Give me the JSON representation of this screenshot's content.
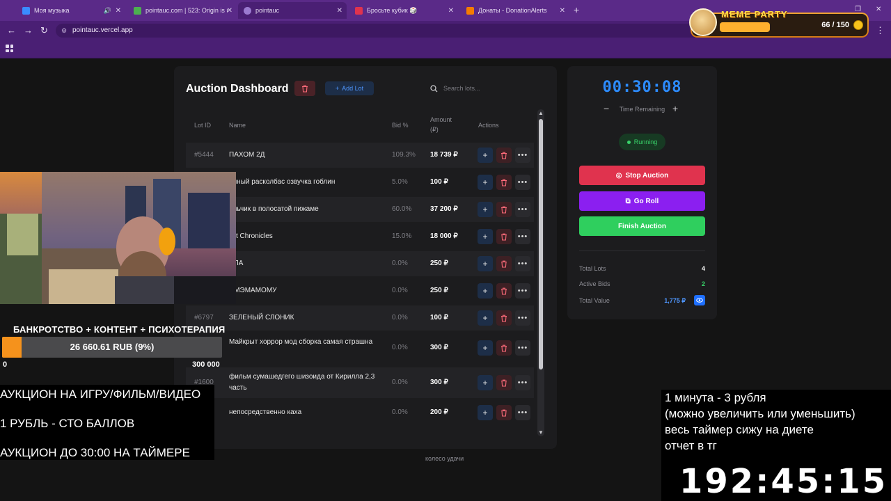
{
  "browser": {
    "tabs": [
      {
        "title": "Моя музыка",
        "active": false,
        "color": "#3a8cff"
      },
      {
        "title": "pointauc.com | 523: Origin is unr",
        "active": false,
        "color": "#4caf50"
      },
      {
        "title": "pointauc",
        "active": true,
        "color": "#9b7ad0"
      },
      {
        "title": "Бросьте кубик 🎲",
        "active": false,
        "color": "#e0334e"
      },
      {
        "title": "Донаты - DonationAlerts",
        "active": false,
        "color": "#f57c00"
      }
    ],
    "url": "pointauc.vercel.app"
  },
  "meme_widget": {
    "label": "MEME PARTY",
    "count": "66 / 150"
  },
  "dashboard": {
    "title": "Auction Dashboard",
    "add_lot_label": "Add Lot",
    "search_placeholder": "Search lots...",
    "columns": {
      "lot_id": "Lot ID",
      "name": "Name",
      "bid": "Bid %",
      "amount": "Amount",
      "amount_unit": "(₽)",
      "actions": "Actions"
    },
    "lots": [
      {
        "id": "#5444",
        "name": "ПАХОМ 2Д",
        "bid": "109.3%",
        "amount": "18 739 ₽"
      },
      {
        "id": "",
        "name": "олный расколбас озвучка гоблин",
        "bid": "5.0%",
        "amount": "100 ₽"
      },
      {
        "id": "",
        "name": "альчик в полосатой пижаме",
        "bid": "60.0%",
        "amount": "37 200 ₽"
      },
      {
        "id": "",
        "name": "ilet Chronicles",
        "bid": "15.0%",
        "amount": "18 000 ₽"
      },
      {
        "id": "",
        "name": "ИЛА",
        "bid": "0.0%",
        "amount": "250 ₽"
      },
      {
        "id": "",
        "name": "ИМЭМАМОМУ",
        "bid": "0.0%",
        "amount": "250 ₽"
      },
      {
        "id": "#6797",
        "name": "ЗЕЛЕНЫЙ СЛОНИК",
        "bid": "0.0%",
        "amount": "100 ₽"
      },
      {
        "id": "",
        "name": "Майкрыт хоррор мод сборка самая страшна",
        "bid": "0.0%",
        "amount": "300 ₽"
      },
      {
        "id": "#1600",
        "name": "фильм сумашедгего шизоида от Кирилла 2,3 часть",
        "bid": "0.0%",
        "amount": "300 ₽"
      },
      {
        "id": "",
        "name": "непосредственно каха",
        "bid": "0.0%",
        "amount": "200 ₽"
      }
    ],
    "footer_text": "колесо удачи"
  },
  "control": {
    "timer": "00:30:08",
    "time_label": "Time Remaining",
    "status": "Running",
    "stop_label": "Stop Auction",
    "roll_label": "Go Roll",
    "finish_label": "Finish Auction",
    "stats": {
      "total_lots_label": "Total Lots",
      "total_lots": "4",
      "active_bids_label": "Active Bids",
      "active_bids": "2",
      "total_value_label": "Total Value",
      "total_value": "1,775 ₽"
    },
    "colors": {
      "timer": "#2d8cff",
      "stop": "#e0334e",
      "roll": "#8b1ff0",
      "finish": "#2fcf5e"
    }
  },
  "stream_overlay": {
    "banner": "БАНКРОТСТВО + КОНТЕНТ + ПСИХОТЕРАПИЯ",
    "progress_text": "26 660.61 RUB (9%)",
    "progress_fraction": 0.09,
    "progress_min": "0",
    "progress_max": "300 000",
    "rules": [
      "АУКЦИОН НА ИГРУ/ФИЛЬМ/ВИДЕО",
      "1 РУБЛЬ - СТО БАЛЛОВ",
      "АУКЦИОН ДО 30:00 НА ТАЙМЕРЕ"
    ],
    "terms": [
      "1 минута - 3 рубля",
      "(можно увеличить или уменьшить)",
      "весь таймер сижу на диете",
      "отчет в тг"
    ],
    "big_timer": "192:45:15"
  }
}
